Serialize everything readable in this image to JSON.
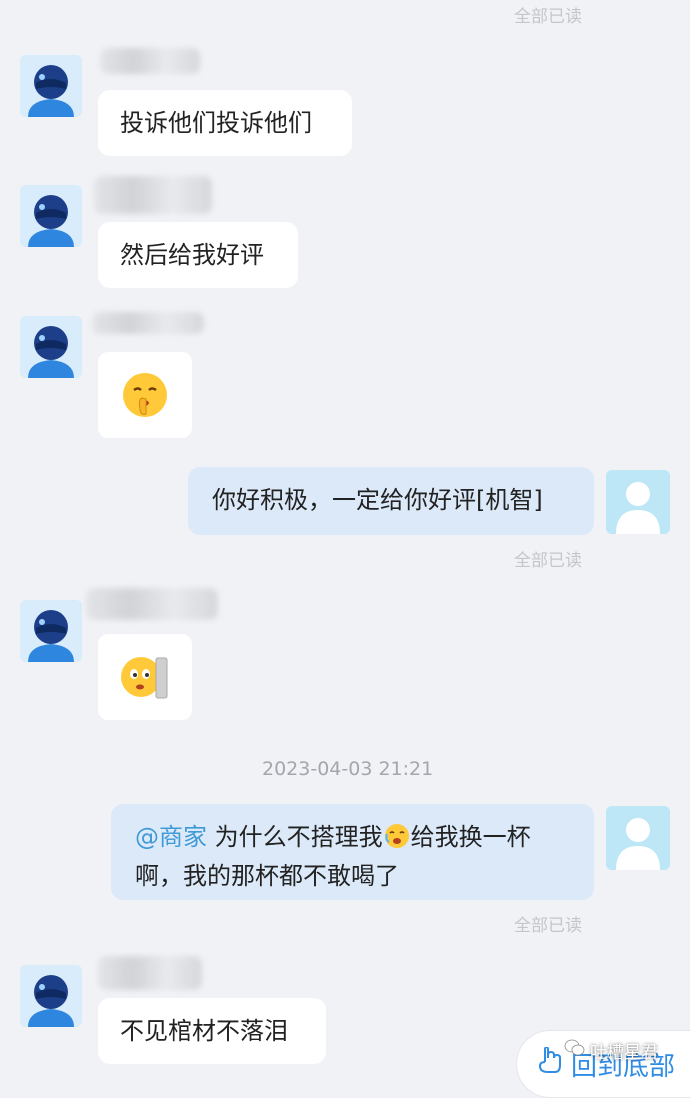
{
  "messages": {
    "read_status": "全部已读",
    "m1_text": "投诉他们投诉他们",
    "m2_text": "然后给我好评",
    "m3_emoji": "shush-face-emoji",
    "m4_text": "你好积极，一定给你好评[机智]",
    "m5_emoji": "peek-wall-emoji",
    "timestamp": "2023-04-03 21:21",
    "m6_mention": "@商家",
    "m6_text1": "为什么不搭理我",
    "m6_text2": "给我换一杯",
    "m6_text3": "啊，我的那杯都不敢喝了",
    "m7_text": "不见棺材不落泪"
  },
  "floating": {
    "back_bottom_label": "回到底部",
    "watermark": "吐槽星君"
  },
  "icons": {
    "rider_avatar": "rider-helmet-avatar-icon",
    "user_avatar": "default-user-avatar-icon",
    "back_bottom": "hand-pointing-down-icon",
    "watermark": "wechat-icon"
  },
  "colors": {
    "background": "#f1f2f6",
    "incoming_bubble": "#ffffff",
    "outgoing_bubble": "#dce9f9",
    "mention": "#3f9ad6",
    "accent": "#2f8de6"
  }
}
